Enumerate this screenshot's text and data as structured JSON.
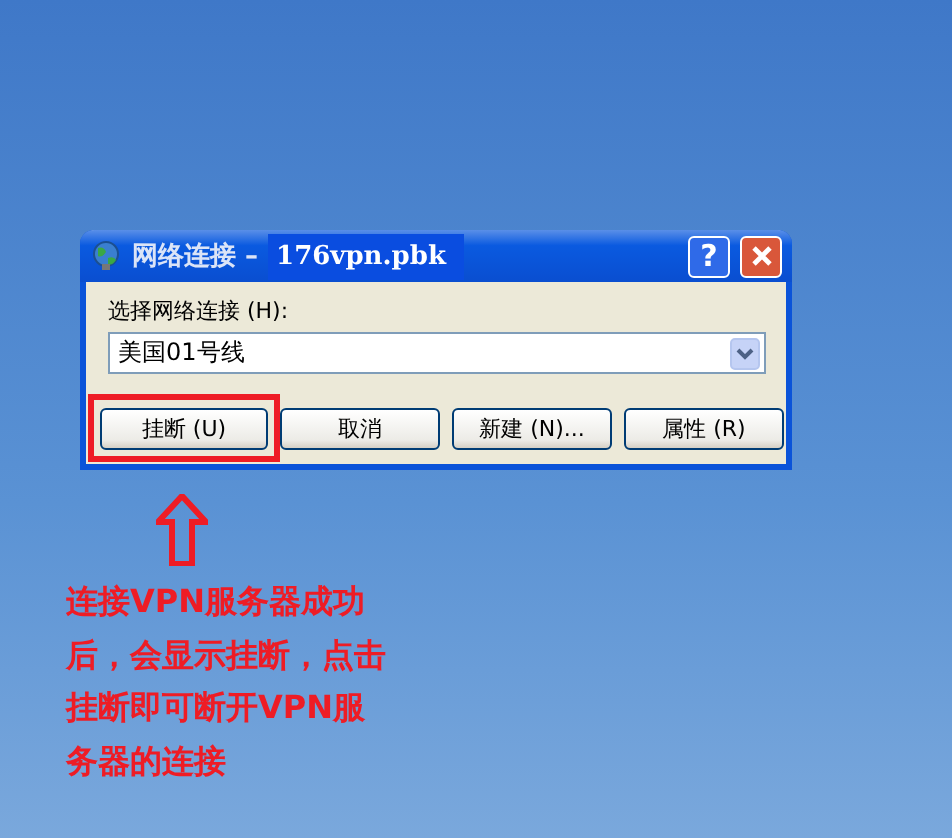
{
  "dialog": {
    "title": "网络连接 –",
    "file_name": "176vpn.pbk",
    "help_button": "?",
    "field_label": "选择网络连接 (H):",
    "connection": {
      "value": "美国01号线"
    },
    "buttons": [
      {
        "label": "挂断 (U)",
        "highlighted": true
      },
      {
        "label": "取消",
        "highlighted": false
      },
      {
        "label": "新建 (N)...",
        "highlighted": false
      },
      {
        "label": "属性 (R)",
        "highlighted": false
      }
    ]
  },
  "annotation": {
    "text": "连接VPN服务器成功后，会显示挂断，点击挂断即可断开VPN服务器的连接"
  }
}
